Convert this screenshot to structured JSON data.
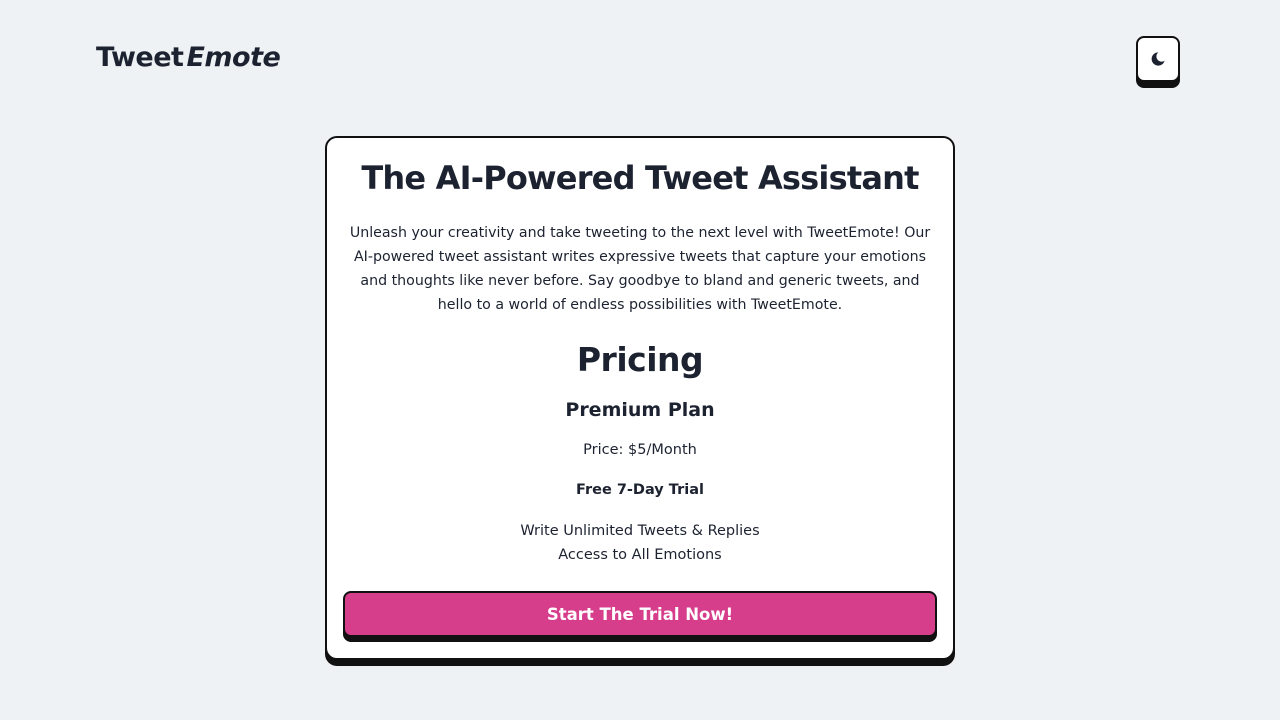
{
  "brand": {
    "name_regular": "Tweet",
    "name_italic": "Emote"
  },
  "header": {
    "theme_toggle_icon": "moon-icon"
  },
  "hero": {
    "title": "The AI-Powered Tweet Assistant",
    "description": "Unleash your creativity and take tweeting to the next level with TweetEmote! Our AI-powered tweet assistant writes expressive tweets that capture your emotions and thoughts like never before. Say goodbye to bland and generic tweets, and hello to a world of endless possibilities with TweetEmote."
  },
  "pricing": {
    "title": "Pricing",
    "plan_name": "Premium Plan",
    "price": "Price: $5/Month",
    "trial": "Free 7-Day Trial",
    "features": [
      "Write Unlimited Tweets & Replies",
      "Access to All Emotions"
    ],
    "cta_label": "Start The Trial Now!"
  },
  "colors": {
    "background": "#eef2f5",
    "text": "#1c2230",
    "accent": "#d63e8c",
    "border": "#111111"
  }
}
